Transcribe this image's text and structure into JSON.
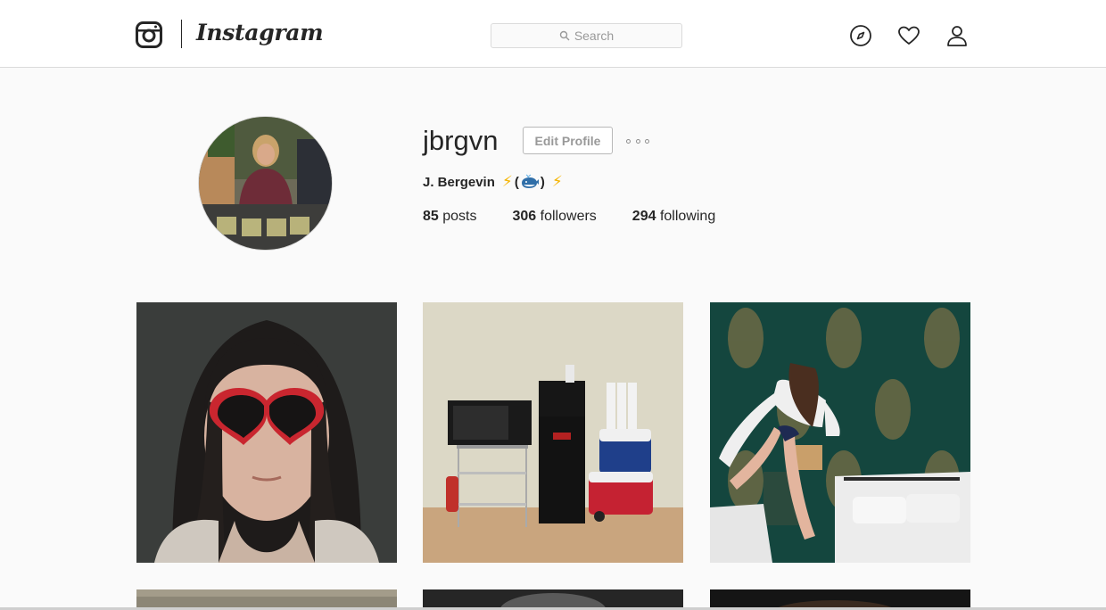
{
  "header": {
    "wordmark": "Instagram",
    "search_placeholder": "Search",
    "nav_icons": [
      "compass-icon",
      "heart-icon",
      "person-icon"
    ]
  },
  "profile": {
    "username": "jbrgvn",
    "edit_label": "Edit Profile",
    "full_name": "J. Bergevin",
    "emoji": [
      "⚡",
      "(",
      "whale",
      ")",
      "⚡"
    ],
    "stats": {
      "posts_count": "85",
      "posts_label": "posts",
      "followers_count": "306",
      "followers_label": "followers",
      "following_count": "294",
      "following_label": "following"
    }
  },
  "posts": [
    {
      "subject": "woman-heart-sunglasses"
    },
    {
      "subject": "office-microwave-watercooler"
    },
    {
      "subject": "girl-jumping-on-bed"
    },
    {
      "subject": "partial-photo"
    },
    {
      "subject": "partial-photo"
    },
    {
      "subject": "partial-photo"
    }
  ],
  "colors": {
    "accent_yellow": "#f5b400",
    "border": "#dbdbdb",
    "text": "#262626",
    "muted": "#999999"
  }
}
